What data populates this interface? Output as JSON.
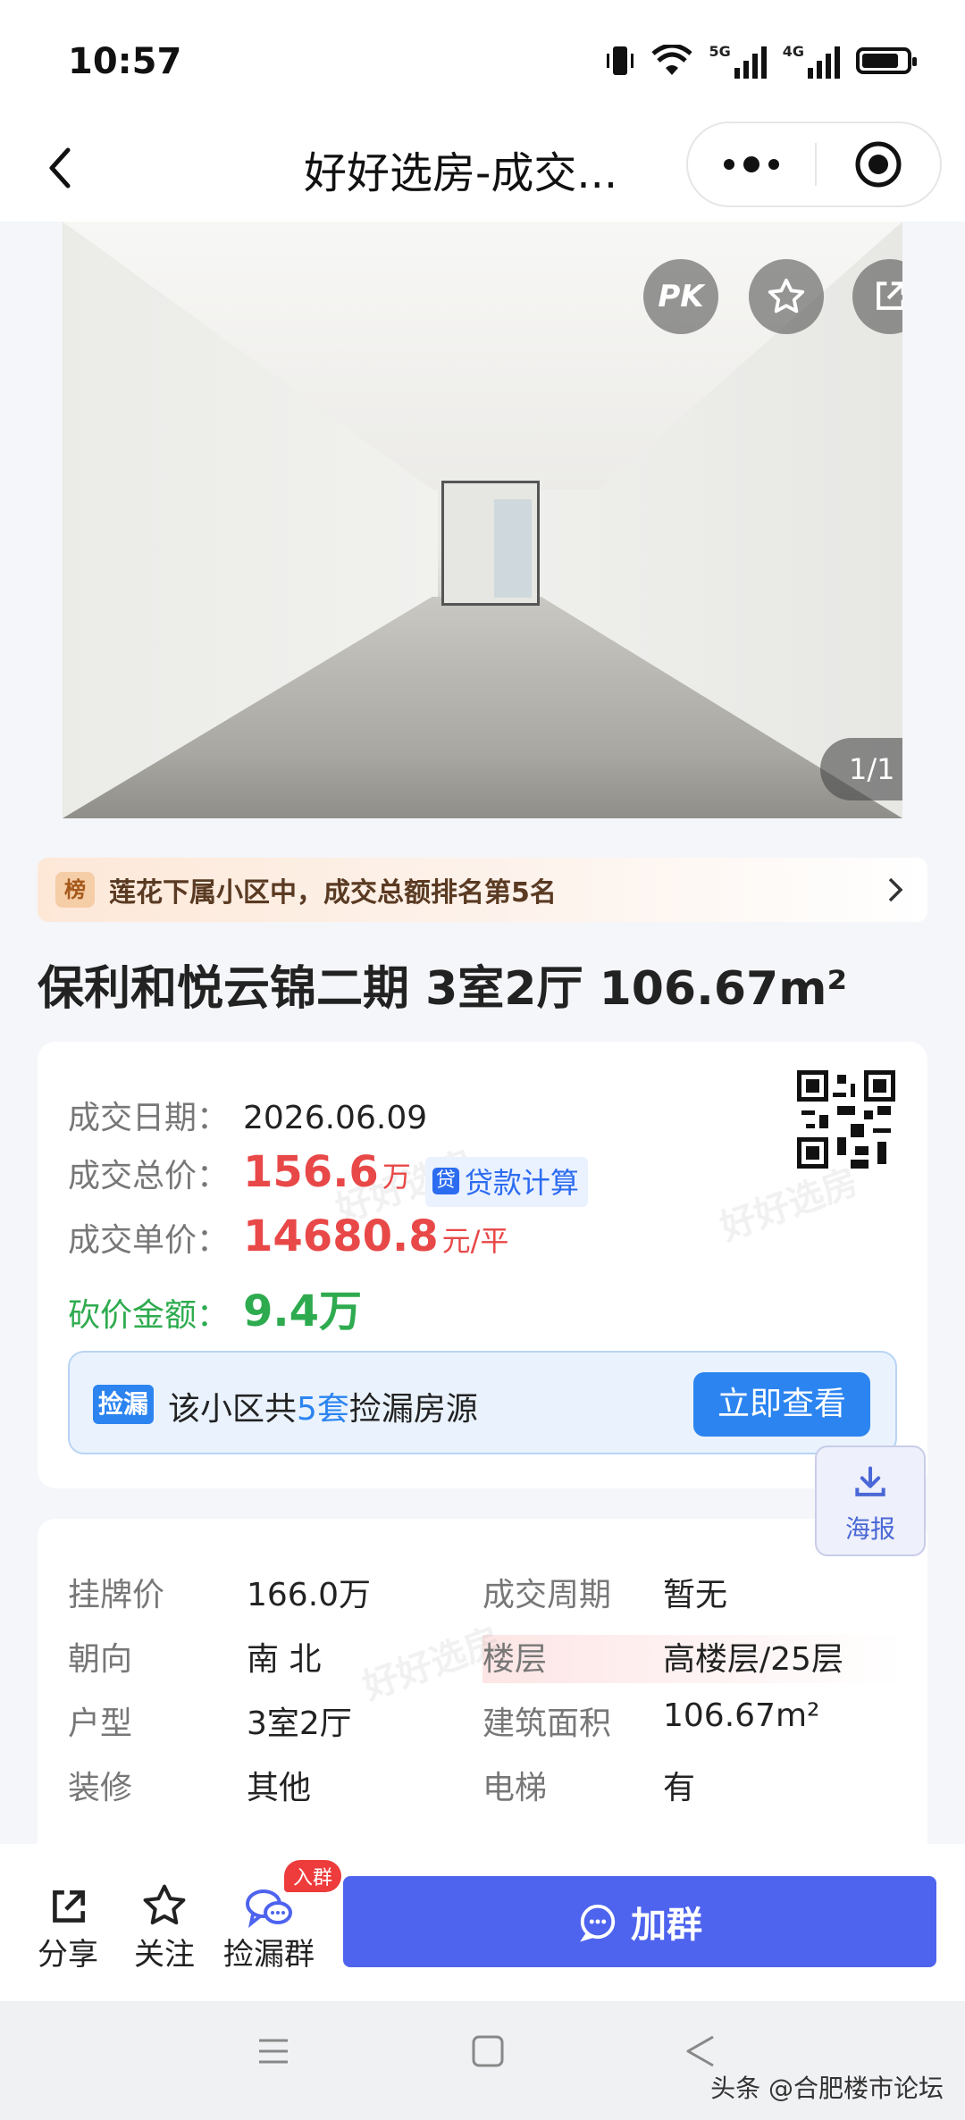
{
  "status_bar": {
    "time": "10:57",
    "signal_5g": "5G",
    "signal_4g": "4G"
  },
  "header": {
    "title": "好好选房-成交..."
  },
  "photo": {
    "pk_label": "PK",
    "counter": "1/1"
  },
  "rank_banner": {
    "tag": "榜",
    "text": "莲花下属小区中，成交总额排名第5名"
  },
  "listing": {
    "title": "保利和悦云锦二期 3室2厅 106.67m²"
  },
  "deal": {
    "date_label": "成交日期：",
    "date": "2026.06.09",
    "total_label": "成交总价：",
    "total": "156.6",
    "total_unit": "万",
    "loan_icon": "贷",
    "loan_label": "贷款计算",
    "unit_label": "成交单价：",
    "unit_price": "14680.8",
    "unit_price_unit": "元/平",
    "bargain_label": "砍价金额：",
    "bargain": "9.4万"
  },
  "pick": {
    "tag": "捡漏",
    "text_before": "该小区共",
    "count": "5套",
    "text_after": "捡漏房源",
    "button": "立即查看"
  },
  "poster": {
    "label": "海报"
  },
  "specs": [
    {
      "label": "挂牌价",
      "value": "166.0万"
    },
    {
      "label": "成交周期",
      "value": "暂无"
    },
    {
      "label": "朝向",
      "value": "南 北"
    },
    {
      "label": "楼层",
      "value": "高楼层/25层"
    },
    {
      "label": "户型",
      "value": "3室2厅"
    },
    {
      "label": "建筑面积",
      "value": "106.67m²"
    },
    {
      "label": "装修",
      "value": "其他"
    },
    {
      "label": "电梯",
      "value": "有"
    }
  ],
  "bottom_bar": {
    "share": "分享",
    "follow": "关注",
    "group": "捡漏群",
    "group_badge": "入群",
    "join": "加群"
  },
  "watermark": "头条 @合肥楼市论坛",
  "colors": {
    "primary": "#4e63ee",
    "price_red": "#e84848",
    "bargain_green": "#2eab4f",
    "link_blue": "#2c84f0"
  }
}
